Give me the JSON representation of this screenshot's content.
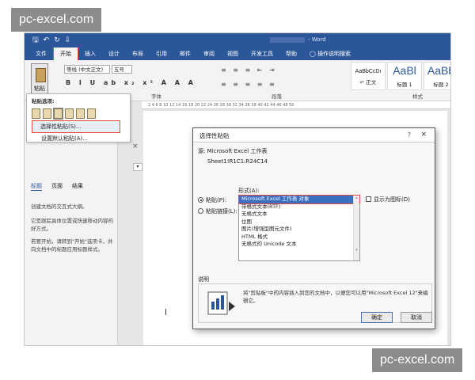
{
  "watermark": "pc-excel.com",
  "titlebar": {
    "qat_icons": [
      "save-icon",
      "undo-icon",
      "redo-icon",
      "customize-icon"
    ],
    "app_name": "- Word"
  },
  "tabs": [
    "文件",
    "开始",
    "插入",
    "设计",
    "布局",
    "引用",
    "邮件",
    "审阅",
    "视图",
    "开发工具",
    "帮助"
  ],
  "tell_me": "操作说明搜索",
  "ribbon": {
    "paste_label": "粘贴",
    "font_name": "等线 (中文正文)",
    "font_size": "五号",
    "font_group": "字体",
    "paragraph_group": "段落",
    "styles_group": "样式",
    "styles": [
      {
        "preview": "AaBbCcDı",
        "name": "↵ 正文"
      },
      {
        "preview": "AaBl",
        "name": "标题 1"
      },
      {
        "preview": "AaBb",
        "name": "标题 2"
      }
    ]
  },
  "ruler_text": "2 4 6 8 10 12 14 16 18 20 22 24 26 28 30 32 34 36 38 40 42 44 46 48 50",
  "paste_menu": {
    "header": "粘贴选项:",
    "items": [
      "选择性粘贴(S)...",
      "设置默认粘贴(A)..."
    ]
  },
  "nav_pane": {
    "tabs": [
      "标题",
      "页面",
      "结果"
    ],
    "paragraphs": [
      "创建文档的交互式大纲。",
      "它是跟踪具体位置或快速移动内容的好方式。",
      "若要开始，请转到\"开始\"选项卡，并向文档中的标题应用标题样式。"
    ]
  },
  "dialog": {
    "title": "选择性粘贴",
    "help": "?",
    "close": "×",
    "source_label": "源:",
    "source_value": "Microsoft Excel 工作表",
    "source_range": "Sheet1!R1C1:R24C14",
    "as_label": "形式(A):",
    "options": [
      {
        "label": "粘贴(P):",
        "checked": true
      },
      {
        "label": "粘贴链接(L):",
        "checked": false
      }
    ],
    "formats": [
      "Microsoft Excel 工作表 对象",
      "带格式文本(RTF)",
      "无格式文本",
      "位图",
      "图片(增强型图元文件)",
      "HTML 格式",
      "无格式的 Unicode 文本"
    ],
    "selected_format": 0,
    "display_as_icon": "显示为图标(D)",
    "result_label": "说明",
    "result_text": "将\"剪贴板\"中的内容插入到您的文档中，以便您可以用\"Microsoft Excel 12\"来编辑它。",
    "ok": "确定",
    "cancel": "取消"
  }
}
